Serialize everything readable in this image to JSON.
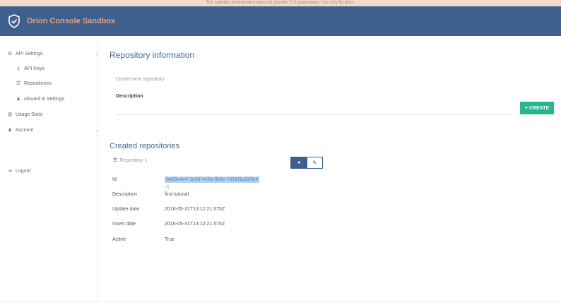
{
  "banner": {
    "text": "The sandbox environment does not provide TLS guarantees. Use only for tests."
  },
  "header": {
    "app_title": "Orion Console Sandbox",
    "brand_color": "#3f5f8f",
    "title_color": "#e9a07a"
  },
  "sidebar": {
    "items": [
      {
        "label": "API Settings",
        "icon": "gear-icon"
      },
      {
        "label": "API Keys",
        "icon": "key-icon"
      },
      {
        "label": "Repositories",
        "icon": "list-icon"
      },
      {
        "label": "uGuard & Settings",
        "icon": "user-icon"
      },
      {
        "label": "Usage Stats",
        "icon": "chart-icon"
      },
      {
        "label": "Account",
        "icon": "person-icon"
      },
      {
        "label": "Logout",
        "icon": "logout-icon"
      }
    ]
  },
  "main": {
    "repo_info_title": "Repository information",
    "create_placeholder": "Create new repository",
    "description_label": "Description",
    "create_button": "+ CREATE",
    "created_title": "Created repositories",
    "repo_tag": "Repository 1",
    "fields": [
      {
        "key": "Id",
        "value": "0a65c4e4-1e0d-4c5a-9b3c-7d2ef1a2b9c4",
        "selected": true
      },
      {
        "key": "Description",
        "value": "first tutorial"
      },
      {
        "key": "Update date",
        "value": "2016-05-31T13:12:21.575Z"
      },
      {
        "key": "Insert date",
        "value": "2016-05-31T13:12:21.575Z"
      },
      {
        "key": "Active",
        "value": "True"
      }
    ],
    "accent_color": "#26b58f"
  }
}
